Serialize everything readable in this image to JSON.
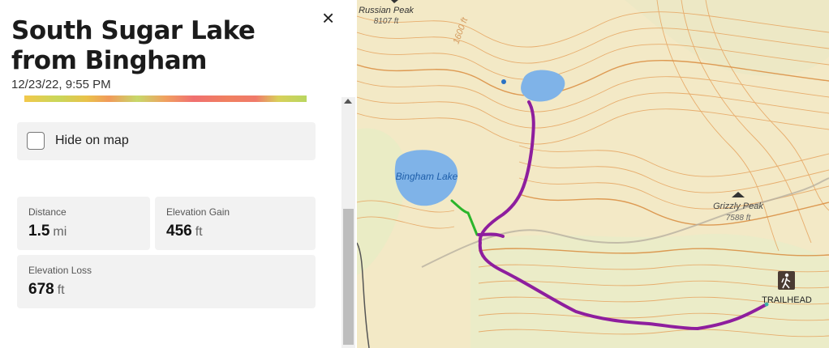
{
  "panel": {
    "title": "South Sugar Lake from Bingham",
    "date": "12/23/22, 9:55 PM",
    "close_icon": "×",
    "hide_on_map_label": "Hide on map",
    "stats": {
      "distance": {
        "label": "Distance",
        "value": "1.5",
        "unit": "mi"
      },
      "elevation_gain": {
        "label": "Elevation Gain",
        "value": "456",
        "unit": "ft"
      },
      "elevation_loss": {
        "label": "Elevation Loss",
        "value": "678",
        "unit": "ft"
      }
    }
  },
  "map": {
    "labels": {
      "russian_peak": "Russian Peak",
      "russian_peak_elev": "8107 ft",
      "contour": "1600 ft",
      "bingham_lake": "Bingham Lake",
      "grizzly_peak": "Grizzly Peak",
      "grizzly_peak_elev": "7588 ft",
      "trailhead": "TRAILHEAD"
    },
    "colors": {
      "route": "#8e1e9e",
      "route_segment": "#2bb52b",
      "lake": "#7fb3e8",
      "terrain": "#f3e9c6",
      "contour": "#e6a35e"
    },
    "icons": [
      "peak-icon",
      "hiker-icon"
    ]
  }
}
